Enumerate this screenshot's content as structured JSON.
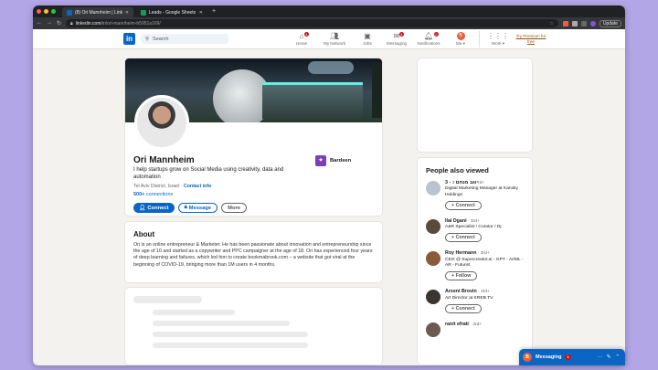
{
  "browser": {
    "tabs": [
      {
        "title": "(8) Ori Mannheim | LinkedIn",
        "fav_color": "#0a66c2",
        "active": true
      },
      {
        "title": "Leads - Google Sheets",
        "fav_color": "#0f9d58",
        "active": false
      }
    ],
    "url_domain": "linkedin.com",
    "url_path": "/in/ori-mannheim-b5951a169/",
    "update_label": "Update"
  },
  "nav": {
    "search_placeholder": "Search",
    "items": [
      {
        "label": "Home",
        "badge": "4"
      },
      {
        "label": "My Network",
        "badge": ""
      },
      {
        "label": "Jobs",
        "badge": ""
      },
      {
        "label": "Messaging",
        "badge": "4"
      },
      {
        "label": "Notifications",
        "badge": "2"
      }
    ],
    "me_label": "Me ▾",
    "me_initial": "B",
    "work_label": "Work ▾",
    "premium_label": "Try Premium for free"
  },
  "profile": {
    "name": "Ori Mannheim",
    "headline": "I help startups grow on Social Media using creativity, data and automation",
    "location": "Tel Aviv District, Israel",
    "contact_info": "Contact info",
    "connections_count": "500+",
    "connections_label": "connections",
    "company": "Bardeen",
    "buttons": {
      "connect": "Connect",
      "message": "Message",
      "more": "More"
    }
  },
  "about": {
    "title": "About",
    "text": "Ori is an online entrepreneur & Marketer. He has been passionate about innovation and entrepreneurship since the age of 10 and started as a copywriter and PPC campaigner at the age of 18. Ori has experienced four years of deep learning and failures, which led him to create bookmabrook.com – a website that got viral at the beginning of COVID-19, bringing more than 1M users in 4 months."
  },
  "people_also_viewed": {
    "title": "People also viewed",
    "people": [
      {
        "name": "3 - יוגב מנחם",
        "degree": "3rd+",
        "headline": "Digital Marketing Manager at Kansky Holdings",
        "action": "Connect",
        "avatar_color": "#b8c4cf"
      },
      {
        "name": "Ilai Dgani",
        "degree": "· 3rd+",
        "headline": "A&R Specialist / Curator / Dj",
        "action": "Connect",
        "avatar_color": "#5a4a3e"
      },
      {
        "name": "Roy Hermann",
        "degree": "· 3rd+",
        "headline": "CEO @ Supercreator.ai - GPT - AI/ML - AR - Futurist",
        "action": "Follow",
        "avatar_color": "#8a5a3a"
      },
      {
        "name": "Arseni Brovin",
        "degree": "· 3rd+",
        "headline": "Art Director at KREB.TV",
        "action": "Connect",
        "avatar_color": "#3a3530"
      },
      {
        "name": "ranit efrati",
        "degree": "· 3rd+",
        "headline": "",
        "action": "",
        "avatar_color": "#6a5a50"
      }
    ]
  },
  "messaging": {
    "label": "Messaging",
    "count": "1",
    "initial": "B"
  }
}
